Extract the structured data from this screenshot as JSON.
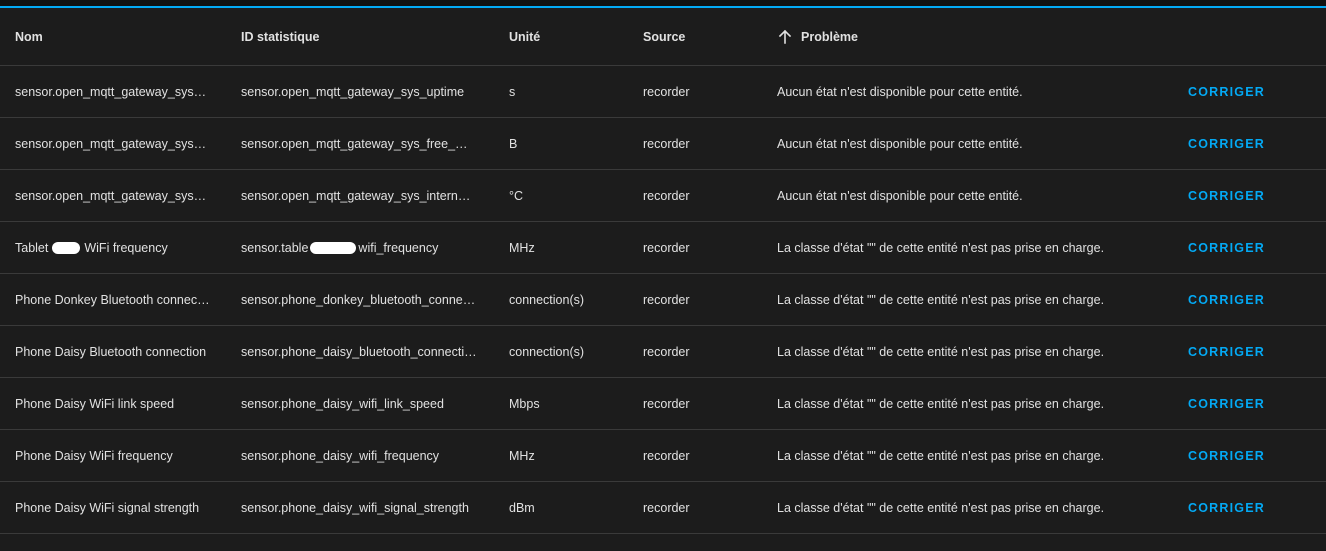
{
  "colors": {
    "background": "#1c1c1c",
    "accent": "#03a9f4",
    "text": "#e1e1e1",
    "divider": "#3a3a3a"
  },
  "table": {
    "headers": {
      "name": "Nom",
      "statistic_id": "ID statistique",
      "unit": "Unité",
      "source": "Source",
      "problem": "Problème",
      "problem_sort_icon": "arrow-up-icon"
    },
    "rows": [
      {
        "name": "sensor.open_mqtt_gateway_sys_uptime",
        "statistic_id": "sensor.open_mqtt_gateway_sys_uptime",
        "unit": "s",
        "source": "recorder",
        "problem": "Aucun état n'est disponible pour cette entité.",
        "action": "CORRIGER"
      },
      {
        "name": "sensor.open_mqtt_gateway_sys_free_memory",
        "statistic_id": "sensor.open_mqtt_gateway_sys_free_memory",
        "unit": "B",
        "source": "recorder",
        "problem": "Aucun état n'est disponible pour cette entité.",
        "action": "CORRIGER"
      },
      {
        "name": "sensor.open_mqtt_gateway_sys_internal_temperature",
        "statistic_id": "sensor.open_mqtt_gateway_sys_internal_temperature",
        "unit": "°C",
        "source": "recorder",
        "problem": "Aucun état n'est disponible pour cette entité.",
        "action": "CORRIGER"
      },
      {
        "name_prefix": "Tablet",
        "name_suffix": "WiFi frequency",
        "statistic_id_prefix": "sensor.table",
        "statistic_id_suffix": "wifi_frequency",
        "unit": "MHz",
        "source": "recorder",
        "problem": "La classe d'état \"\" de cette entité n'est pas prise en charge.",
        "action": "CORRIGER"
      },
      {
        "name": "Phone Donkey Bluetooth connection",
        "statistic_id": "sensor.phone_donkey_bluetooth_connection",
        "unit": "connection(s)",
        "source": "recorder",
        "problem": "La classe d'état \"\" de cette entité n'est pas prise en charge.",
        "action": "CORRIGER"
      },
      {
        "name": "Phone Daisy Bluetooth connection",
        "statistic_id": "sensor.phone_daisy_bluetooth_connection",
        "unit": "connection(s)",
        "source": "recorder",
        "problem": "La classe d'état \"\" de cette entité n'est pas prise en charge.",
        "action": "CORRIGER"
      },
      {
        "name": "Phone Daisy WiFi link speed",
        "statistic_id": "sensor.phone_daisy_wifi_link_speed",
        "unit": "Mbps",
        "source": "recorder",
        "problem": "La classe d'état \"\" de cette entité n'est pas prise en charge.",
        "action": "CORRIGER"
      },
      {
        "name": "Phone Daisy WiFi frequency",
        "statistic_id": "sensor.phone_daisy_wifi_frequency",
        "unit": "MHz",
        "source": "recorder",
        "problem": "La classe d'état \"\" de cette entité n'est pas prise en charge.",
        "action": "CORRIGER"
      },
      {
        "name": "Phone Daisy WiFi signal strength",
        "statistic_id": "sensor.phone_daisy_wifi_signal_strength",
        "unit": "dBm",
        "source": "recorder",
        "problem": "La classe d'état \"\" de cette entité n'est pas prise en charge.",
        "action": "CORRIGER"
      }
    ]
  }
}
